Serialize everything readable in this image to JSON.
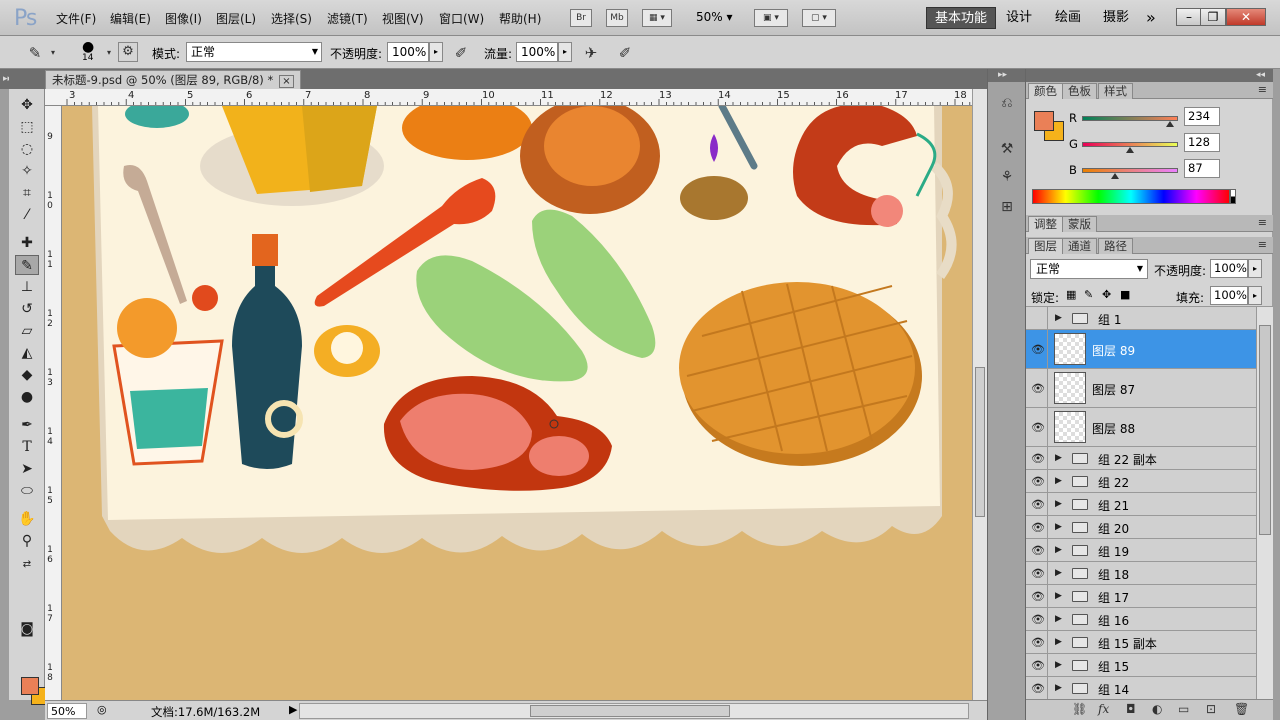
{
  "app": {
    "logo": "Ps"
  },
  "menu": [
    "文件(F)",
    "编辑(E)",
    "图像(I)",
    "图层(L)",
    "选择(S)",
    "滤镜(T)",
    "视图(V)",
    "窗口(W)",
    "帮助(H)"
  ],
  "menubar_icons": {
    "bridge": "Br",
    "minibridge": "Mb"
  },
  "zoom_select": "50%",
  "workspaces": [
    "基本功能",
    "设计",
    "绘画",
    "摄影"
  ],
  "workspace_more": "»",
  "window_buttons": {
    "minimize": "–",
    "restore": "❐",
    "close": "✕"
  },
  "options": {
    "brush_size": "14",
    "mode_label": "模式:",
    "mode_value": "正常",
    "opacity_label": "不透明度:",
    "opacity_value": "100%",
    "flow_label": "流量:",
    "flow_value": "100%"
  },
  "document": {
    "tab_title": "未标题-9.psd @ 50% (图层 89, RGB/8) *",
    "close": "×"
  },
  "ruler": {
    "top": [
      "3",
      "4",
      "5",
      "6",
      "7",
      "8",
      "9",
      "10",
      "11",
      "12",
      "13",
      "14",
      "15",
      "16",
      "17",
      "18"
    ],
    "left": [
      "9",
      "1 0",
      "1 1",
      "1 2",
      "1 3",
      "1 4",
      "1 5",
      "1 6",
      "1 7",
      "1 8"
    ]
  },
  "status": {
    "zoom": "50%",
    "doc_size": "文档:17.6M/163.2M"
  },
  "color_panel": {
    "tabs": [
      "颜色",
      "色板",
      "样式"
    ],
    "channels": [
      {
        "label": "R",
        "value": "234",
        "fraction": 0.918
      },
      {
        "label": "G",
        "value": "128",
        "fraction": 0.502
      },
      {
        "label": "B",
        "value": "87",
        "fraction": 0.341
      }
    ],
    "foreground": "#ea8057",
    "background": "#f5b21b"
  },
  "adjust_panel": {
    "tabs": [
      "调整",
      "蒙版"
    ]
  },
  "layers_panel": {
    "tabs": [
      "图层",
      "通道",
      "路径"
    ],
    "blend_mode": "正常",
    "opacity_label": "不透明度:",
    "opacity_value": "100%",
    "lock_label": "锁定:",
    "fill_label": "填充:",
    "fill_value": "100%",
    "layers": [
      {
        "name": "组 1",
        "type": "group",
        "visible": false
      },
      {
        "name": "图层 89",
        "type": "layer",
        "visible": true,
        "selected": true
      },
      {
        "name": "图层 87",
        "type": "layer",
        "visible": true
      },
      {
        "name": "图层 88",
        "type": "layer",
        "visible": true
      },
      {
        "name": "组 22 副本",
        "type": "group",
        "visible": true
      },
      {
        "name": "组 22",
        "type": "group",
        "visible": true
      },
      {
        "name": "组 21",
        "type": "group",
        "visible": true
      },
      {
        "name": "组 20",
        "type": "group",
        "visible": true
      },
      {
        "name": "组 19",
        "type": "group",
        "visible": true
      },
      {
        "name": "组 18",
        "type": "group",
        "visible": true
      },
      {
        "name": "组 17",
        "type": "group",
        "visible": true
      },
      {
        "name": "组 16",
        "type": "group",
        "visible": true
      },
      {
        "name": "组 15 副本",
        "type": "group",
        "visible": true
      },
      {
        "name": "组 15",
        "type": "group",
        "visible": true
      },
      {
        "name": "组 14",
        "type": "group",
        "visible": true
      }
    ]
  },
  "panel_menu": "≡",
  "collapse": "◂◂",
  "expand": "▸▸"
}
